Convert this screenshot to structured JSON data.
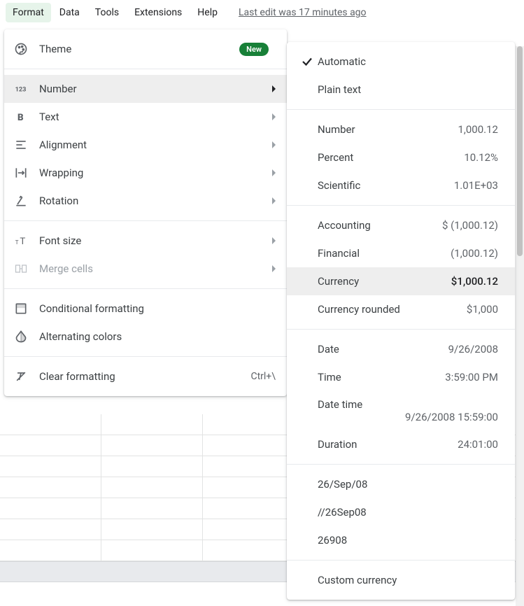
{
  "menubar": {
    "items": [
      "Format",
      "Data",
      "Tools",
      "Extensions",
      "Help"
    ],
    "last_edit": "Last edit was 17 minutes ago"
  },
  "format_menu": {
    "theme": {
      "label": "Theme",
      "badge": "New"
    },
    "number": {
      "label": "Number"
    },
    "text": {
      "label": "Text"
    },
    "alignment": {
      "label": "Alignment"
    },
    "wrapping": {
      "label": "Wrapping"
    },
    "rotation": {
      "label": "Rotation"
    },
    "font_size": {
      "label": "Font size"
    },
    "merge_cells": {
      "label": "Merge cells"
    },
    "conditional": {
      "label": "Conditional formatting"
    },
    "alternating": {
      "label": "Alternating colors"
    },
    "clear": {
      "label": "Clear formatting",
      "shortcut": "Ctrl+\\"
    }
  },
  "number_submenu": {
    "automatic": {
      "label": "Automatic",
      "checked": true
    },
    "plain_text": {
      "label": "Plain text"
    },
    "number": {
      "label": "Number",
      "example": "1,000.12"
    },
    "percent": {
      "label": "Percent",
      "example": "10.12%"
    },
    "scientific": {
      "label": "Scientific",
      "example": "1.01E+03"
    },
    "accounting": {
      "label": "Accounting",
      "example": "$ (1,000.12)"
    },
    "financial": {
      "label": "Financial",
      "example": "(1,000.12)"
    },
    "currency": {
      "label": "Currency",
      "example": "$1,000.12"
    },
    "currency_rounded": {
      "label": "Currency rounded",
      "example": "$1,000"
    },
    "date": {
      "label": "Date",
      "example": "9/26/2008"
    },
    "time": {
      "label": "Time",
      "example": "3:59:00 PM"
    },
    "date_time": {
      "label": "Date time",
      "example": "9/26/2008 15:59:00"
    },
    "duration": {
      "label": "Duration",
      "example": "24:01:00"
    },
    "custom1": {
      "label": "26/Sep/08"
    },
    "custom2": {
      "label": "//26Sep08"
    },
    "custom3": {
      "label": "26908"
    },
    "custom_currency": {
      "label": "Custom currency"
    }
  }
}
